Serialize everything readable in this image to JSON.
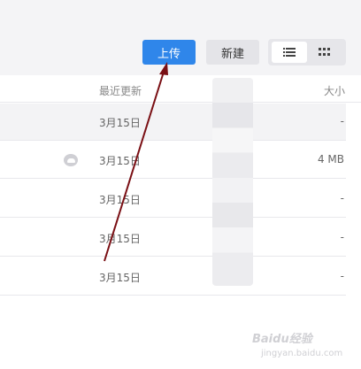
{
  "toolbar": {
    "upload_label": "上传",
    "new_label": "新建",
    "view_list_icon": "list-icon",
    "view_grid_icon": "grid-icon"
  },
  "table": {
    "header_date": "最近更新",
    "header_size": "大小",
    "rows": [
      {
        "date": "3月15日",
        "size": "-"
      },
      {
        "date": "3月15日",
        "size": "4 MB",
        "icon": "cloud-icon"
      },
      {
        "date": "3月15日",
        "size": "-"
      },
      {
        "date": "3月15日",
        "size": "-"
      },
      {
        "date": "3月15日",
        "size": "-"
      }
    ]
  },
  "watermark": {
    "main": "Baidu经验",
    "sub": "jingyan.baidu.com"
  },
  "colors": {
    "accent": "#2f86ea",
    "arrow": "#7a0f14"
  }
}
